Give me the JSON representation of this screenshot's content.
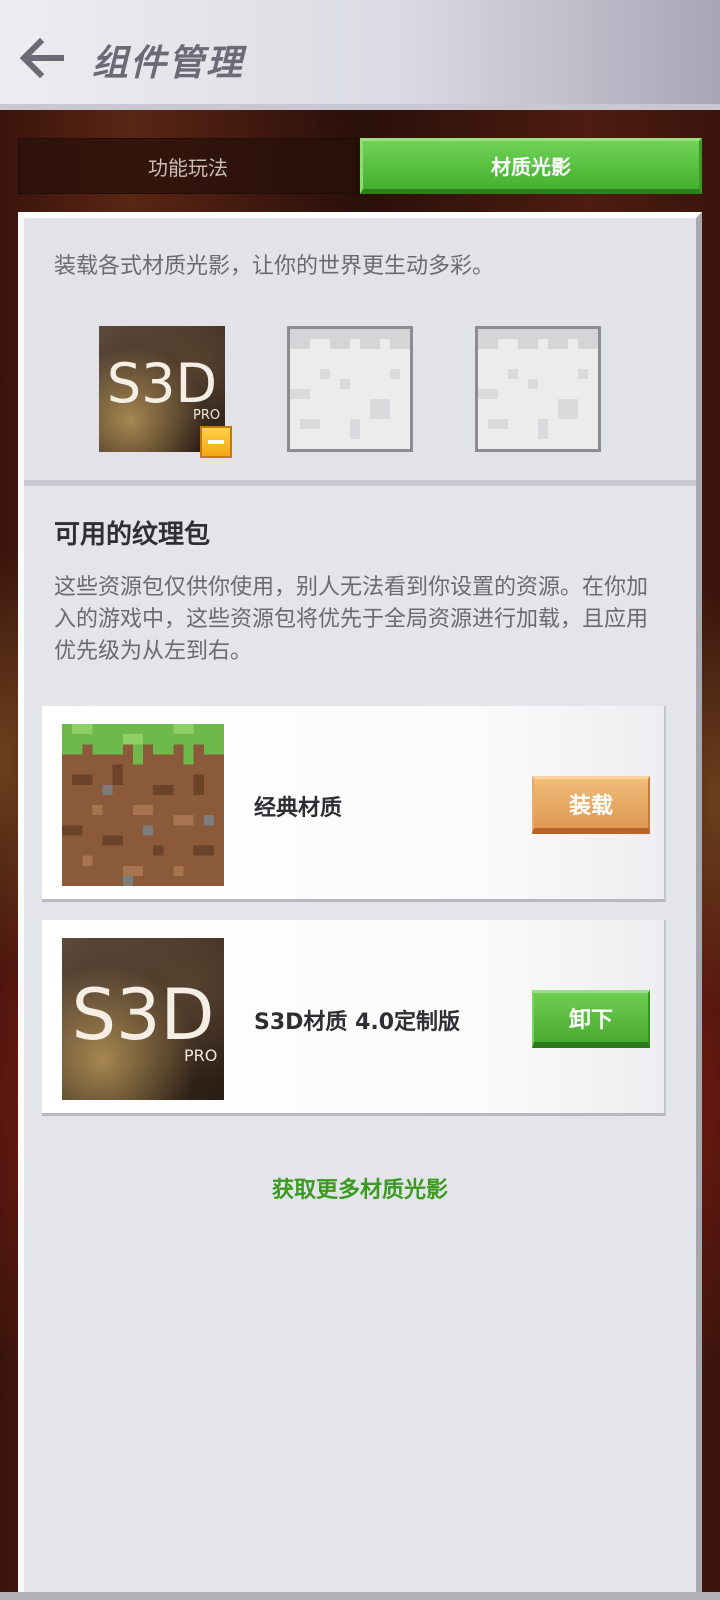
{
  "header": {
    "title": "组件管理",
    "back_icon": "back-arrow-icon"
  },
  "tabs": [
    {
      "label": "功能玩法",
      "active": false
    },
    {
      "label": "材质光影",
      "active": true
    }
  ],
  "equipped": {
    "intro": "装载各式材质光影，让你的世界更生动多彩。",
    "slots": [
      {
        "logo_text": "S3D",
        "logo_sub": "PRO",
        "remove_icon": "minus-icon"
      },
      {
        "empty": true
      },
      {
        "empty": true
      }
    ]
  },
  "available": {
    "title": "可用的纹理包",
    "description": "这些资源包仅供你使用，别人无法看到你设置的资源。在你加入的游戏中，这些资源包将优先于全局资源进行加载，且应用优先级为从左到右。",
    "packs": [
      {
        "name": "经典材质",
        "action": "装载",
        "thumb": "grass-block-icon"
      },
      {
        "name": "S3D材质 4.0定制版",
        "action": "卸下",
        "thumb": "s3d-pro-logo",
        "logo_text": "S3D",
        "logo_sub": "PRO"
      }
    ],
    "more_link": "获取更多材质光影"
  },
  "colors": {
    "accent_green": "#45b02f",
    "link_green": "#3c9a22",
    "load_orange": "#df9856"
  }
}
